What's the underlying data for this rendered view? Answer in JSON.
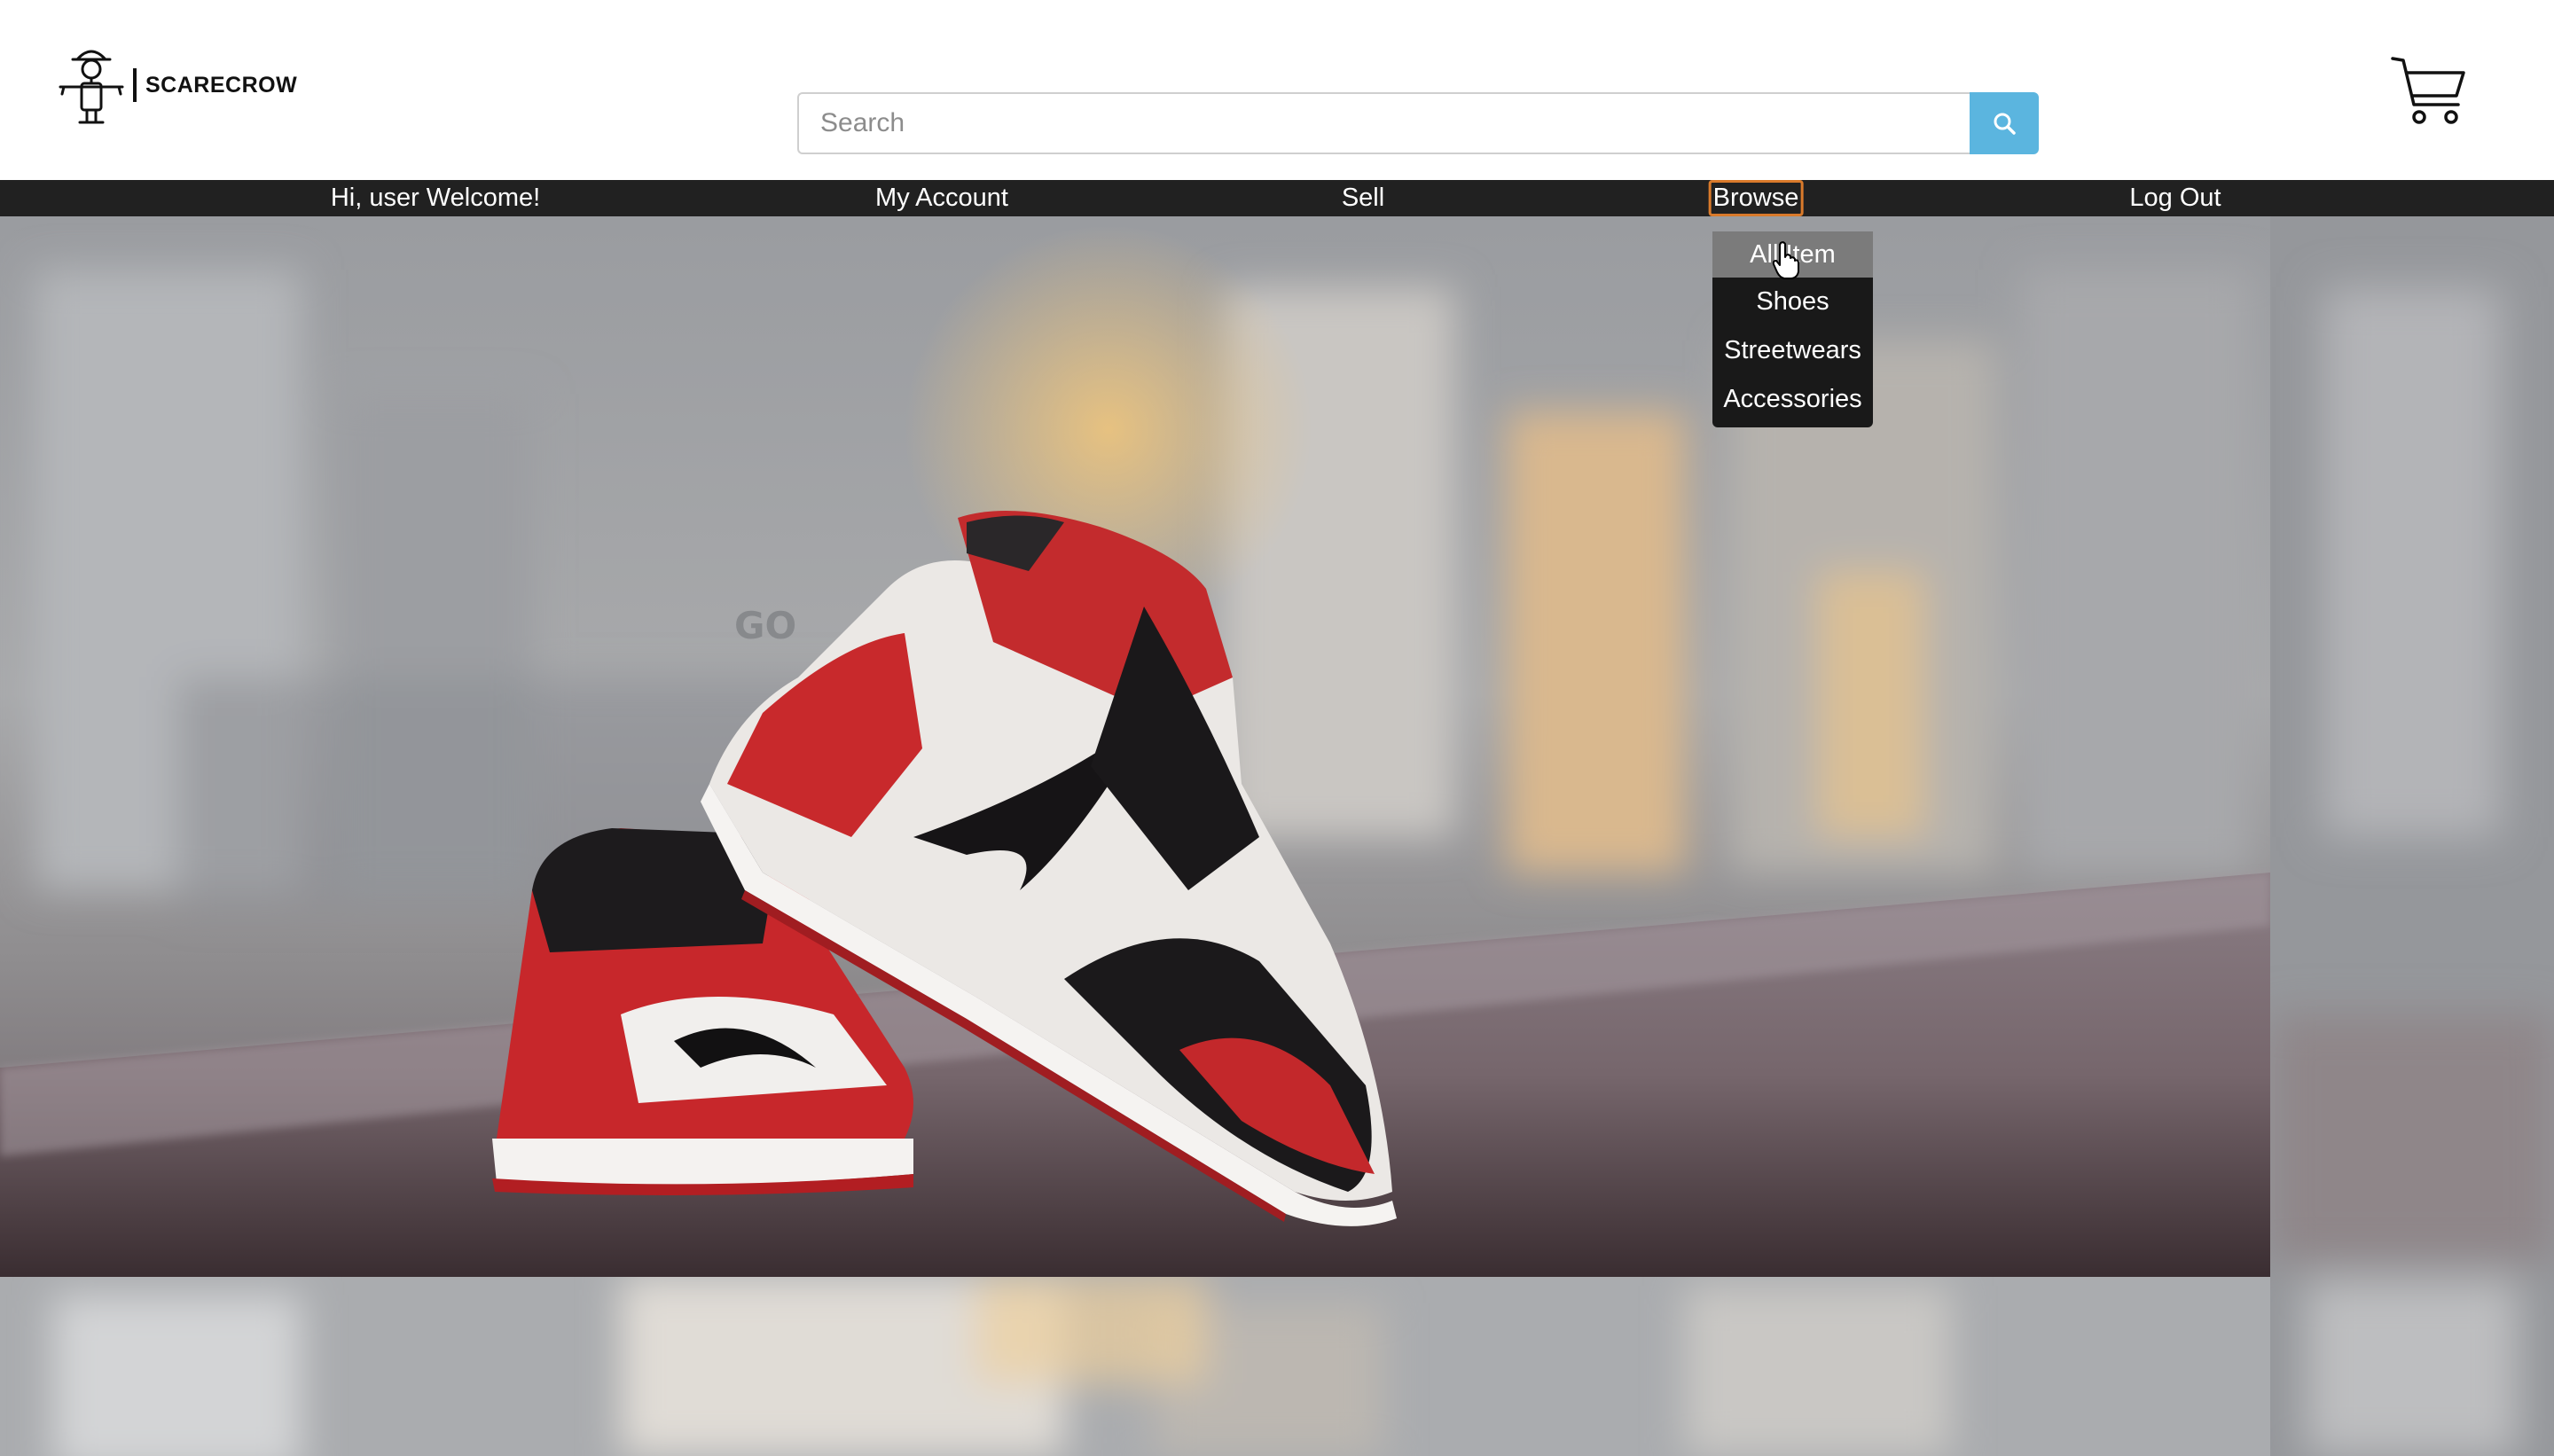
{
  "brand": {
    "name": "SCARECROW"
  },
  "search": {
    "placeholder": "Search",
    "value": "",
    "button_icon": "search-icon"
  },
  "cart": {
    "icon": "cart-icon"
  },
  "nav": {
    "items": [
      {
        "label": "Hi, user Welcome!"
      },
      {
        "label": "My Account"
      },
      {
        "label": "Sell"
      },
      {
        "label": "Browse",
        "active": true
      },
      {
        "label": "Log Out"
      }
    ]
  },
  "browse_menu": {
    "items": [
      {
        "label": "All Item",
        "hovered": true
      },
      {
        "label": "Shoes"
      },
      {
        "label": "Streetwears"
      },
      {
        "label": "Accessories"
      }
    ]
  },
  "hero": {
    "watermark": "GO"
  },
  "colors": {
    "nav_bg": "#212121",
    "search_button": "#5bb5df",
    "active_outline": "#d97a2b",
    "dropdown_bg": "#191919",
    "dropdown_hover": "#7b7b7b"
  }
}
